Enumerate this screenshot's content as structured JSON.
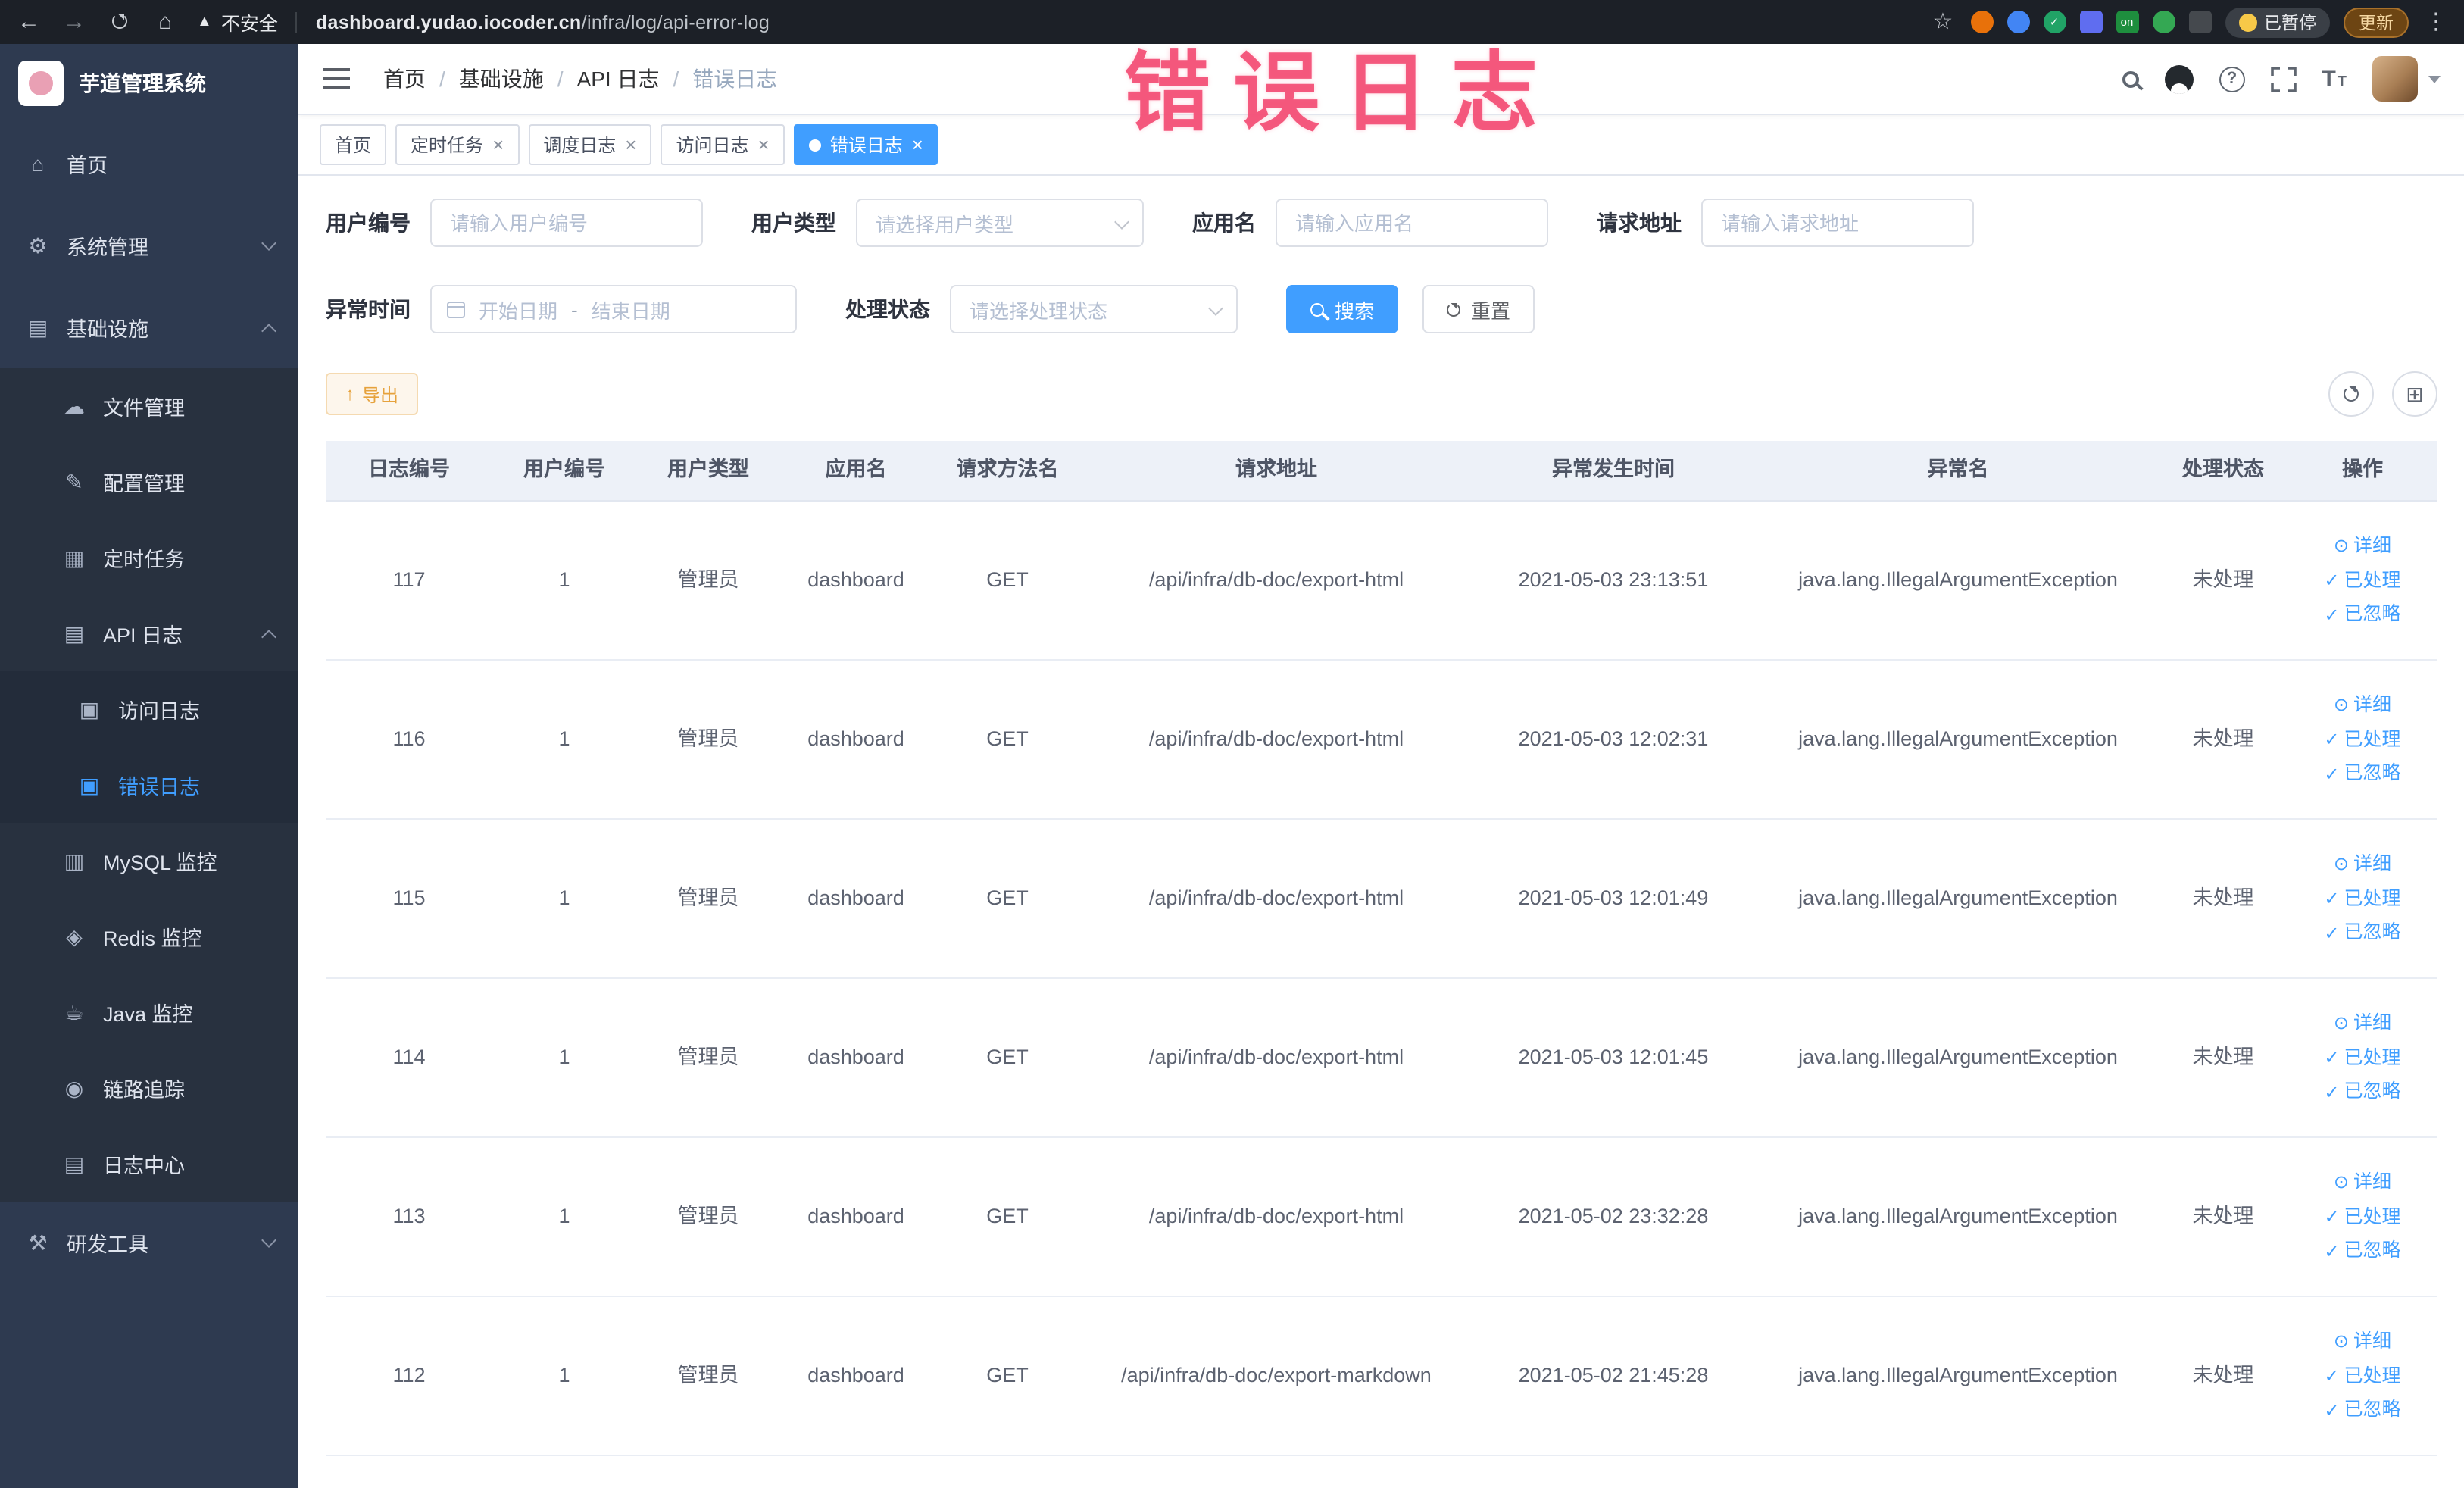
{
  "browser": {
    "security_label": "不安全",
    "url_domain": "dashboard.yudao.iocoder.cn",
    "url_path": "/infra/log/api-error-log",
    "paused_label": "已暂停",
    "update_label": "更新",
    "ext_on_label": "on"
  },
  "sidebar": {
    "app_title": "芋道管理系统",
    "items": [
      {
        "label": "首页",
        "glyph": "⌂"
      },
      {
        "label": "系统管理",
        "glyph": "⚙"
      },
      {
        "label": "基础设施",
        "glyph": "▤"
      },
      {
        "label": "文件管理",
        "glyph": "☁"
      },
      {
        "label": "配置管理",
        "glyph": "✎"
      },
      {
        "label": "定时任务",
        "glyph": "▦"
      },
      {
        "label": "API 日志",
        "glyph": "▤"
      },
      {
        "label": "访问日志",
        "glyph": "▣"
      },
      {
        "label": "错误日志",
        "glyph": "▣"
      },
      {
        "label": "MySQL 监控",
        "glyph": "▥"
      },
      {
        "label": "Redis 监控",
        "glyph": "◈"
      },
      {
        "label": "Java 监控",
        "glyph": "☕"
      },
      {
        "label": "链路追踪",
        "glyph": "◉"
      },
      {
        "label": "日志中心",
        "glyph": "▤"
      },
      {
        "label": "研发工具",
        "glyph": "⚒"
      }
    ]
  },
  "header": {
    "breadcrumb": {
      "items": [
        "首页",
        "基础设施",
        "API 日志",
        "错误日志"
      ],
      "separator": "/"
    }
  },
  "tabs": [
    {
      "label": "首页"
    },
    {
      "label": "定时任务"
    },
    {
      "label": "调度日志"
    },
    {
      "label": "访问日志"
    },
    {
      "label": "错误日志"
    }
  ],
  "filters": {
    "user_id": {
      "label": "用户编号",
      "placeholder": "请输入用户编号"
    },
    "user_type": {
      "label": "用户类型",
      "placeholder": "请选择用户类型"
    },
    "app_name": {
      "label": "应用名",
      "placeholder": "请输入应用名"
    },
    "request_url": {
      "label": "请求地址",
      "placeholder": "请输入请求地址"
    },
    "exception_time": {
      "label": "异常时间",
      "start_placeholder": "开始日期",
      "separator": "-",
      "end_placeholder": "结束日期"
    },
    "process_status": {
      "label": "处理状态",
      "placeholder": "请选择处理状态"
    },
    "search_label": "搜索",
    "reset_label": "重置"
  },
  "toolbar": {
    "export_label": "导出"
  },
  "table": {
    "columns": [
      "日志编号",
      "用户编号",
      "用户类型",
      "应用名",
      "请求方法名",
      "请求地址",
      "异常发生时间",
      "异常名",
      "处理状态",
      "操作"
    ],
    "actions": [
      "详细",
      "已处理",
      "已忽略"
    ],
    "rows": [
      {
        "id": "117",
        "user_id": "1",
        "user_type": "管理员",
        "app": "dashboard",
        "method": "GET",
        "url": "/api/infra/db-doc/export-html",
        "time": "2021-05-03 23:13:51",
        "exception": "java.lang.IllegalArgumentException",
        "status": "未处理"
      },
      {
        "id": "116",
        "user_id": "1",
        "user_type": "管理员",
        "app": "dashboard",
        "method": "GET",
        "url": "/api/infra/db-doc/export-html",
        "time": "2021-05-03 12:02:31",
        "exception": "java.lang.IllegalArgumentException",
        "status": "未处理"
      },
      {
        "id": "115",
        "user_id": "1",
        "user_type": "管理员",
        "app": "dashboard",
        "method": "GET",
        "url": "/api/infra/db-doc/export-html",
        "time": "2021-05-03 12:01:49",
        "exception": "java.lang.IllegalArgumentException",
        "status": "未处理"
      },
      {
        "id": "114",
        "user_id": "1",
        "user_type": "管理员",
        "app": "dashboard",
        "method": "GET",
        "url": "/api/infra/db-doc/export-html",
        "time": "2021-05-03 12:01:45",
        "exception": "java.lang.IllegalArgumentException",
        "status": "未处理"
      },
      {
        "id": "113",
        "user_id": "1",
        "user_type": "管理员",
        "app": "dashboard",
        "method": "GET",
        "url": "/api/infra/db-doc/export-html",
        "time": "2021-05-02 23:32:28",
        "exception": "java.lang.IllegalArgumentException",
        "status": "未处理"
      },
      {
        "id": "112",
        "user_id": "1",
        "user_type": "管理员",
        "app": "dashboard",
        "method": "GET",
        "url": "/api/infra/db-doc/export-markdown",
        "time": "2021-05-02 21:45:28",
        "exception": "java.lang.IllegalArgumentException",
        "status": "未处理"
      }
    ]
  },
  "annotation": {
    "text": "错误日志"
  },
  "icons": {
    "back": "←",
    "forward": "→",
    "home": "⌂",
    "star": "☆",
    "more": "⋮",
    "warning": "▲",
    "close": "×",
    "check": "✓",
    "view": "⊙",
    "grid": "⊞",
    "question": "?",
    "export_arrow": "↑",
    "font_big": "T",
    "font_small": "T"
  },
  "colors": {
    "accent": "#409eff",
    "warning": "#e6a23c",
    "annotation": "#f3466e"
  }
}
